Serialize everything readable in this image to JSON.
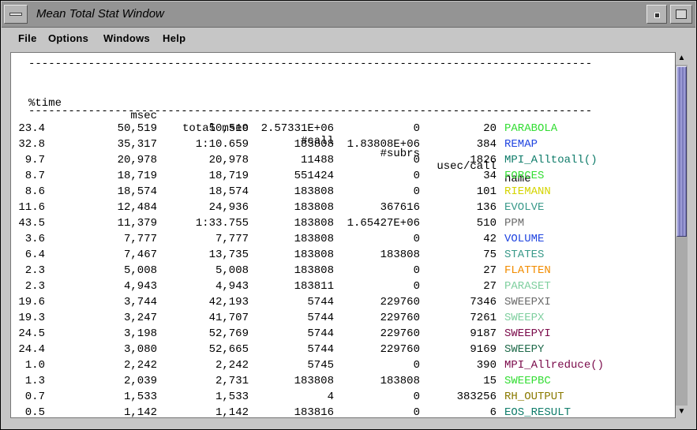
{
  "window": {
    "title": "Mean Total Stat Window"
  },
  "menu": [
    "File",
    "Options",
    "Windows",
    "Help"
  ],
  "table": {
    "separator": "-------------------------------------------------------------------------------------",
    "columns": [
      "%time",
      "msec",
      "total msec",
      "#call",
      "#subrs",
      "usec/call",
      "name"
    ],
    "rows": [
      {
        "pct": "23.4",
        "msec": "50,519",
        "total": "50,519",
        "calls": "2.57331E+06",
        "subrs": "0",
        "usec": "20",
        "name": "PARABOLA",
        "color": "#33dd33"
      },
      {
        "pct": "32.8",
        "msec": "35,317",
        "total": "1:10.659",
        "calls": "183808",
        "subrs": "1.83808E+06",
        "usec": "384",
        "name": "REMAP",
        "color": "#1f44e0"
      },
      {
        "pct": "9.7",
        "msec": "20,978",
        "total": "20,978",
        "calls": "11488",
        "subrs": "0",
        "usec": "1826",
        "name": "MPI_Alltoall()",
        "color": "#0f7c6a"
      },
      {
        "pct": "8.7",
        "msec": "18,719",
        "total": "18,719",
        "calls": "551424",
        "subrs": "0",
        "usec": "34",
        "name": "FORCES",
        "color": "#33dd33"
      },
      {
        "pct": "8.6",
        "msec": "18,574",
        "total": "18,574",
        "calls": "183808",
        "subrs": "0",
        "usec": "101",
        "name": "RIEMANN",
        "color": "#d4d400"
      },
      {
        "pct": "11.6",
        "msec": "12,484",
        "total": "24,936",
        "calls": "183808",
        "subrs": "367616",
        "usec": "136",
        "name": "EVOLVE",
        "color": "#3a9a8a"
      },
      {
        "pct": "43.5",
        "msec": "11,379",
        "total": "1:33.755",
        "calls": "183808",
        "subrs": "1.65427E+06",
        "usec": "510",
        "name": "PPM",
        "color": "#6a6a6a"
      },
      {
        "pct": "3.6",
        "msec": "7,777",
        "total": "7,777",
        "calls": "183808",
        "subrs": "0",
        "usec": "42",
        "name": "VOLUME",
        "color": "#1f44e0"
      },
      {
        "pct": "6.4",
        "msec": "7,467",
        "total": "13,735",
        "calls": "183808",
        "subrs": "183808",
        "usec": "75",
        "name": "STATES",
        "color": "#3a9a8a"
      },
      {
        "pct": "2.3",
        "msec": "5,008",
        "total": "5,008",
        "calls": "183808",
        "subrs": "0",
        "usec": "27",
        "name": "FLATTEN",
        "color": "#f28c00"
      },
      {
        "pct": "2.3",
        "msec": "4,943",
        "total": "4,943",
        "calls": "183811",
        "subrs": "0",
        "usec": "27",
        "name": "PARASET",
        "color": "#7fcf9f"
      },
      {
        "pct": "19.6",
        "msec": "3,744",
        "total": "42,193",
        "calls": "5744",
        "subrs": "229760",
        "usec": "7346",
        "name": "SWEEPXI",
        "color": "#6a6a6a"
      },
      {
        "pct": "19.3",
        "msec": "3,247",
        "total": "41,707",
        "calls": "5744",
        "subrs": "229760",
        "usec": "7261",
        "name": "SWEEPX",
        "color": "#7fcf9f"
      },
      {
        "pct": "24.5",
        "msec": "3,198",
        "total": "52,769",
        "calls": "5744",
        "subrs": "229760",
        "usec": "9187",
        "name": "SWEEPYI",
        "color": "#7a0a4a"
      },
      {
        "pct": "24.4",
        "msec": "3,080",
        "total": "52,665",
        "calls": "5744",
        "subrs": "229760",
        "usec": "9169",
        "name": "SWEEPY",
        "color": "#1f6a4a"
      },
      {
        "pct": "1.0",
        "msec": "2,242",
        "total": "2,242",
        "calls": "5745",
        "subrs": "0",
        "usec": "390",
        "name": "MPI_Allreduce()",
        "color": "#7a0a4a"
      },
      {
        "pct": "1.3",
        "msec": "2,039",
        "total": "2,731",
        "calls": "183808",
        "subrs": "183808",
        "usec": "15",
        "name": "SWEEPBC",
        "color": "#33dd33"
      },
      {
        "pct": "0.7",
        "msec": "1,533",
        "total": "1,533",
        "calls": "4",
        "subrs": "0",
        "usec": "383256",
        "name": "RH_OUTPUT",
        "color": "#8a7a00"
      },
      {
        "pct": "0.5",
        "msec": "1,142",
        "total": "1,142",
        "calls": "183816",
        "subrs": "0",
        "usec": "6",
        "name": "EOS_RESULT",
        "color": "#0f7c6a"
      }
    ]
  },
  "icons": {
    "window_menu": "window-menu-icon",
    "minimize": "minimize-icon",
    "maximize": "maximize-icon",
    "scroll_up": "arrow-up-icon",
    "scroll_down": "arrow-down-icon"
  }
}
